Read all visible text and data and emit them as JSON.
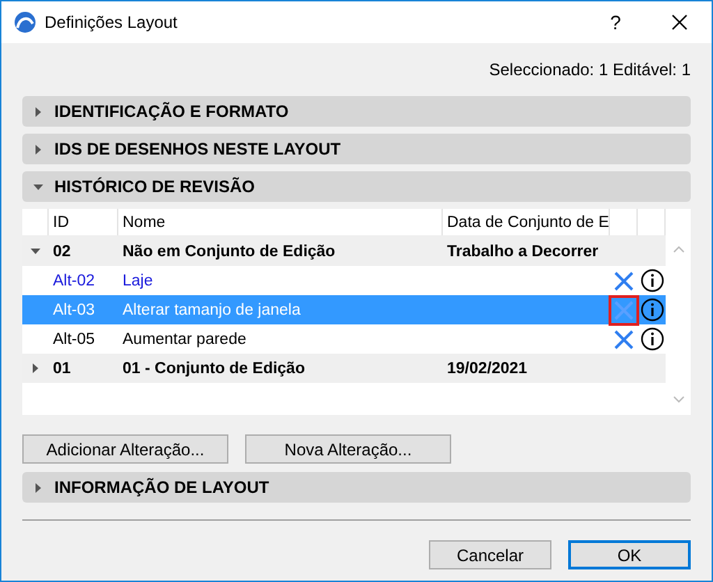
{
  "window": {
    "title": "Definições Layout",
    "help": "?"
  },
  "selection_info": "Seleccionado: 1 Editável: 1",
  "sections_top": [
    {
      "title": "IDENTIFICAÇÃO E FORMATO",
      "expanded": false
    },
    {
      "title": "IDS DE DESENHOS NESTE LAYOUT",
      "expanded": false
    },
    {
      "title": "HISTÓRICO DE REVISÃO",
      "expanded": true
    }
  ],
  "table": {
    "columns": [
      "ID",
      "Nome",
      "Data de Conjunto de E"
    ],
    "groups": [
      {
        "id": "02",
        "name": "Não em Conjunto de Edição",
        "date": "Trabalho a Decorrer",
        "expanded": true,
        "children": [
          {
            "id": "Alt-02",
            "name": "Laje",
            "selected": false,
            "emphasized": true,
            "marked": false
          },
          {
            "id": "Alt-03",
            "name": "Alterar tamanjo de janela",
            "selected": true,
            "emphasized": false,
            "marked": true
          },
          {
            "id": "Alt-05",
            "name": "Aumentar parede",
            "selected": false,
            "emphasized": false,
            "marked": false
          }
        ]
      },
      {
        "id": "01",
        "name": "01 - Conjunto de Edição",
        "date": "19/02/2021",
        "expanded": false
      }
    ]
  },
  "table_buttons": [
    "Adicionar Alteração...",
    "Nova Alteração..."
  ],
  "sections_bottom": [
    {
      "title": "INFORMAÇÃO DE LAYOUT",
      "expanded": false
    }
  ],
  "buttons": [
    {
      "label": "Cancelar",
      "default": false
    },
    {
      "label": "OK",
      "default": true
    }
  ]
}
